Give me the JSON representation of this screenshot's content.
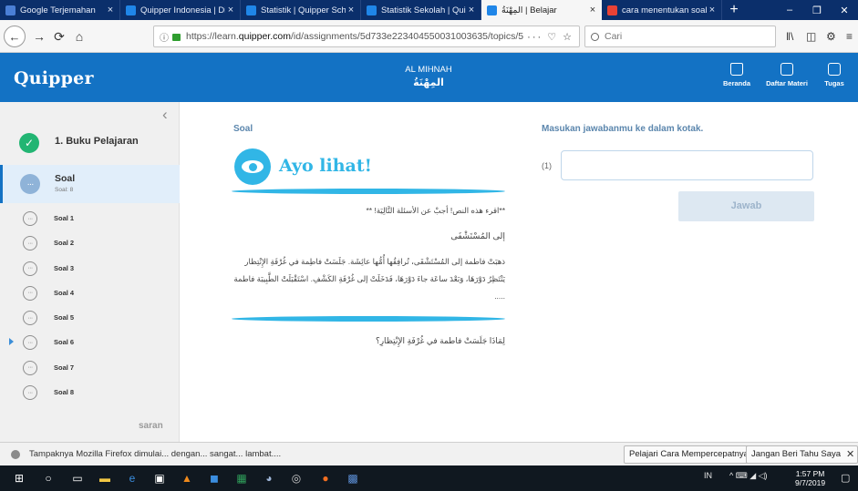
{
  "browser": {
    "tabs": [
      {
        "label": "Google Terjemahan",
        "close": "×",
        "color": "#4a7fd6"
      },
      {
        "label": "Quipper Indonesia | Dist",
        "close": "×",
        "color": "#1f86e8"
      },
      {
        "label": "Statistik | Quipper School",
        "close": "×",
        "color": "#1f86e8"
      },
      {
        "label": "Statistik Sekolah | Quipp",
        "close": "×",
        "color": "#1f86e8"
      },
      {
        "label": "المِهْنَةُ | Belajar",
        "close": "×",
        "color": "#1f86e8",
        "active": true
      },
      {
        "label": "cara menentukan soal va",
        "close": "×",
        "color": "#e94235"
      }
    ],
    "new_tab": "+",
    "window_controls": {
      "minimize": "–",
      "maximize": "❐",
      "close": "✕"
    },
    "nav": {
      "back": "←",
      "forward": "→",
      "reload": "⟳",
      "home": "⌂"
    },
    "url": {
      "info": "ⓘ",
      "prefix": "https://learn.",
      "domain": "quipper.com",
      "rest": "/id/assignments/5d733e223404550031003635/topics/5",
      "actions": "··· ♡ ☆"
    },
    "search_placeholder": "Cari",
    "toolbar_icons": {
      "library": "‖\\",
      "sidebar": "◫",
      "extension": "⚙",
      "menu": "≡"
    }
  },
  "app": {
    "logo": "Quipper",
    "course_title": "AL MIHNAH",
    "course_title_ar": "المِهْنَةُ",
    "nav": [
      {
        "label": "Beranda",
        "icon": "home-icon"
      },
      {
        "label": "Daftar Materi",
        "icon": "materials-icon"
      },
      {
        "label": "Tugas",
        "icon": "assignment-icon"
      }
    ]
  },
  "sidebar": {
    "collapse": "‹",
    "book": {
      "check": "✓",
      "title": "1. Buku Pelajaran"
    },
    "active": {
      "title": "Soal",
      "subtitle": "Soal: 8",
      "dots": "···"
    },
    "items": [
      {
        "label": "Soal 1",
        "dots": "···"
      },
      {
        "label": "Soal 2",
        "dots": "···"
      },
      {
        "label": "Soal 3",
        "dots": "···"
      },
      {
        "label": "Soal 4",
        "dots": "···"
      },
      {
        "label": "Soal 5",
        "dots": "···"
      },
      {
        "label": "Soal 6",
        "dots": "···",
        "current": true
      },
      {
        "label": "Soal 7",
        "dots": "···"
      },
      {
        "label": "Soal 8",
        "dots": "···"
      }
    ],
    "saran": "saran"
  },
  "content": {
    "soal_heading": "Soal",
    "ayo_title": "Ayo lihat!",
    "instruction": "**اقرء هذه النص! أجبْ عن الأسئلة التَّالِيَة! **",
    "passage_title": "إلى المُسْتَشْفَى",
    "passage": "ذهبَتْ فاطمة إلى المُسْتَشْفَى، تُرافِقُها أُمُّها عائِشَة. جَلَسَتْ فاطِمة في غُرْفَةِ الإِنْتِظار يَنْتَظِرُ دَوْرَهَا، وَبَعْدَ ساعَة جاءَ دَوْرَهَا، فَدَخَلَتْ إلى غُرْفَةِ الكَشْفِ. اسْتَقْبَلَتْ الطَّبِيبَة فاطمة .....",
    "question": "لِمَاذَا جَلَسَتْ فاطمة في غُرْفَةِ الإِنْتِظارِ؟"
  },
  "answer": {
    "heading": "Masukan jawabanmu ke dalam kotak.",
    "number": "(1)",
    "value": "",
    "placeholder": "",
    "button": "Jawab"
  },
  "notification": {
    "text": "Tampaknya Mozilla Firefox dimulai... dengan... sangat... lambat....",
    "learn_button": "Pelajari Cara Mempercepatnya",
    "dismiss_button": "Jangan Beri Tahu Saya Lagi",
    "close": "✕"
  },
  "taskbar": {
    "icons": [
      {
        "name": "windows-start-icon",
        "glyph": "⊞"
      },
      {
        "name": "search-icon",
        "glyph": "○"
      },
      {
        "name": "task-view-icon",
        "glyph": "▭"
      },
      {
        "name": "file-explorer-icon",
        "glyph": "▬"
      },
      {
        "name": "edge-icon",
        "glyph": "e"
      },
      {
        "name": "store-icon",
        "glyph": "▣"
      },
      {
        "name": "vlc-icon",
        "glyph": "▲"
      },
      {
        "name": "app-icon",
        "glyph": "◼"
      },
      {
        "name": "excel-icon",
        "glyph": "▦"
      },
      {
        "name": "app2-icon",
        "glyph": "◕"
      },
      {
        "name": "chrome-icon",
        "glyph": "◎"
      },
      {
        "name": "firefox-icon",
        "glyph": "●"
      },
      {
        "name": "app3-icon",
        "glyph": "▩"
      }
    ],
    "lang": "IN",
    "tray": "^ ⌨ ◢ ◁)",
    "time": "1:57 PM",
    "date": "9/7/2019",
    "notif": "▢"
  },
  "colors": {
    "brand": "#1372c4",
    "accent": "#31b6e6",
    "success": "#22b573"
  }
}
